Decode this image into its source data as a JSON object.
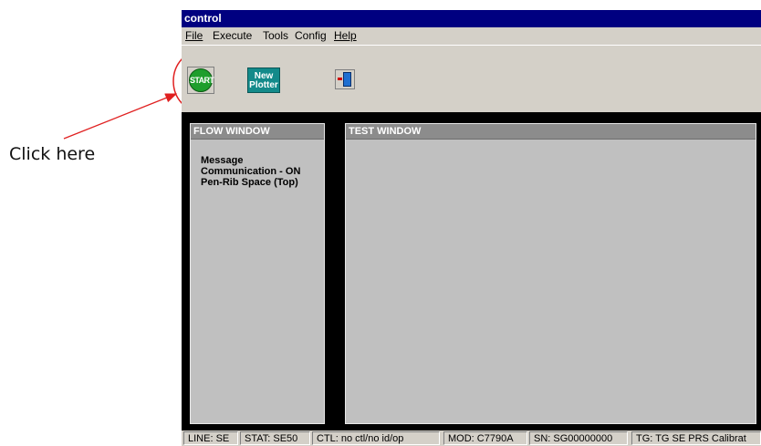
{
  "annotation": {
    "label": "Click here",
    "color": "#e02020"
  },
  "window": {
    "title": "control"
  },
  "menu": {
    "file": "File",
    "execute": "Execute",
    "tools": "Tools",
    "config": "Config",
    "help": "Help"
  },
  "toolbar": {
    "start_label": "START",
    "plotter_line1": "New",
    "plotter_line2": "Plotter",
    "exit_icon": "exit-door-icon"
  },
  "flow_window": {
    "title": "FLOW WINDOW",
    "lines": [
      "Message",
      "Communication - ON",
      "Pen-Rib Space (Top)"
    ]
  },
  "test_window": {
    "title": "TEST WINDOW"
  },
  "status": {
    "line": "LINE: SE",
    "stat": "STAT: SE50",
    "ctl": "CTL: no ctl/no id/op",
    "mod": "MOD: C7790A",
    "sn": "SN: SG00000000",
    "tg": "TG: TG  SE  PRS  Calibrat"
  },
  "colors": {
    "titlebar": "#000080",
    "start_green": "#1e9e2c",
    "plotter_teal": "#138a8a",
    "panel_header": "#8c8c8c"
  }
}
